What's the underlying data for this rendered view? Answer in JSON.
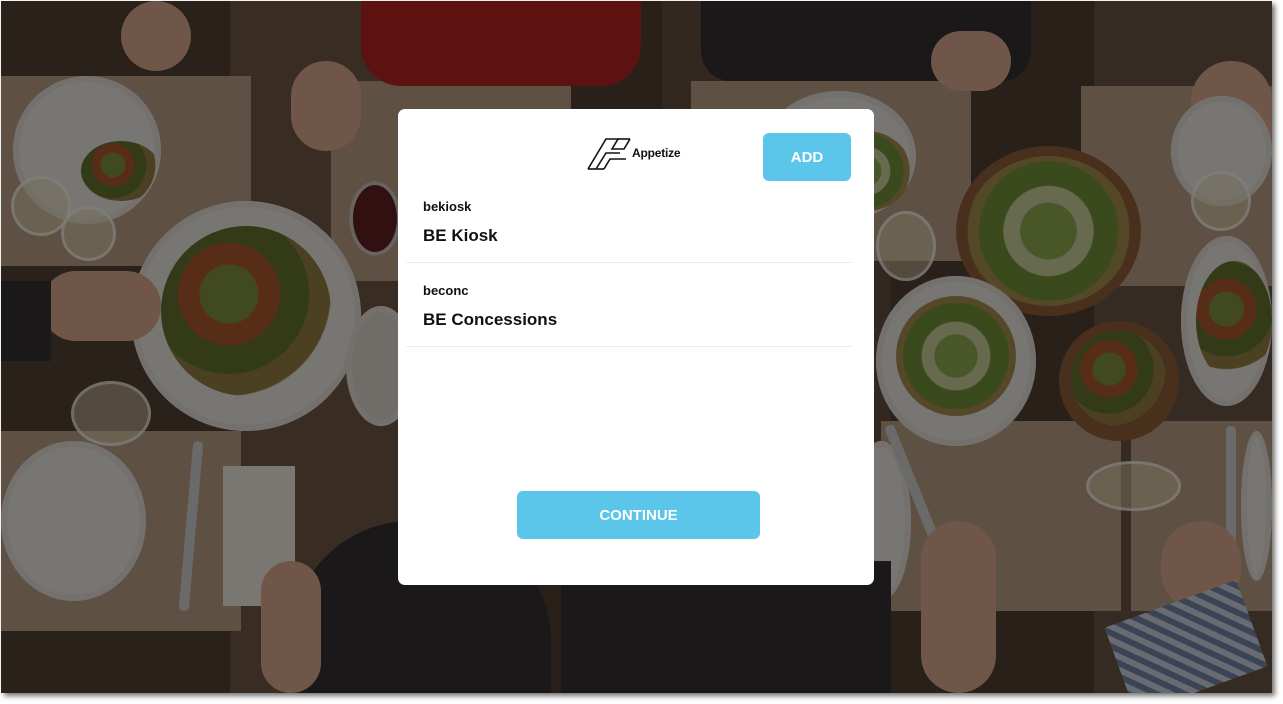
{
  "brand": {
    "logo_icon": "appetize-logo-icon",
    "name": "Appetize"
  },
  "header": {
    "add_label": "ADD"
  },
  "venues": [
    {
      "code": "bekiosk",
      "name": "BE Kiosk"
    },
    {
      "code": "beconc",
      "name": "BE Concessions"
    }
  ],
  "footer": {
    "continue_label": "CONTINUE"
  },
  "colors": {
    "accent": "#5bc5ea",
    "modal_background": "#ffffff",
    "text": "#111111"
  }
}
